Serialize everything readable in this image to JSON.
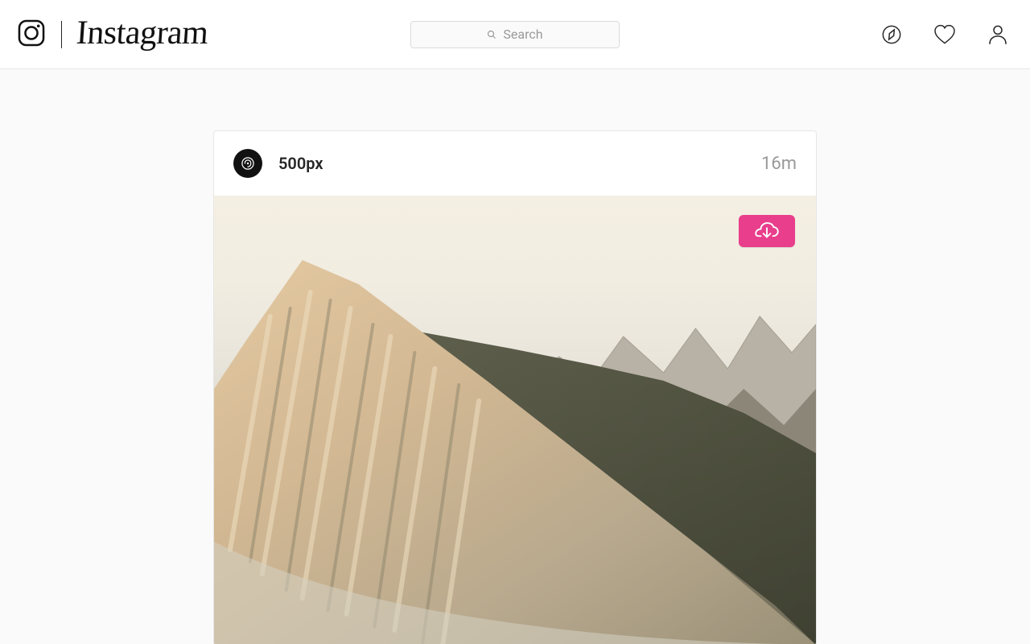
{
  "header": {
    "wordmark": "Instagram",
    "search_placeholder": "Search"
  },
  "post": {
    "author": "500px",
    "timestamp": "16m"
  },
  "colors": {
    "download_button_bg": "#e83e8c"
  }
}
